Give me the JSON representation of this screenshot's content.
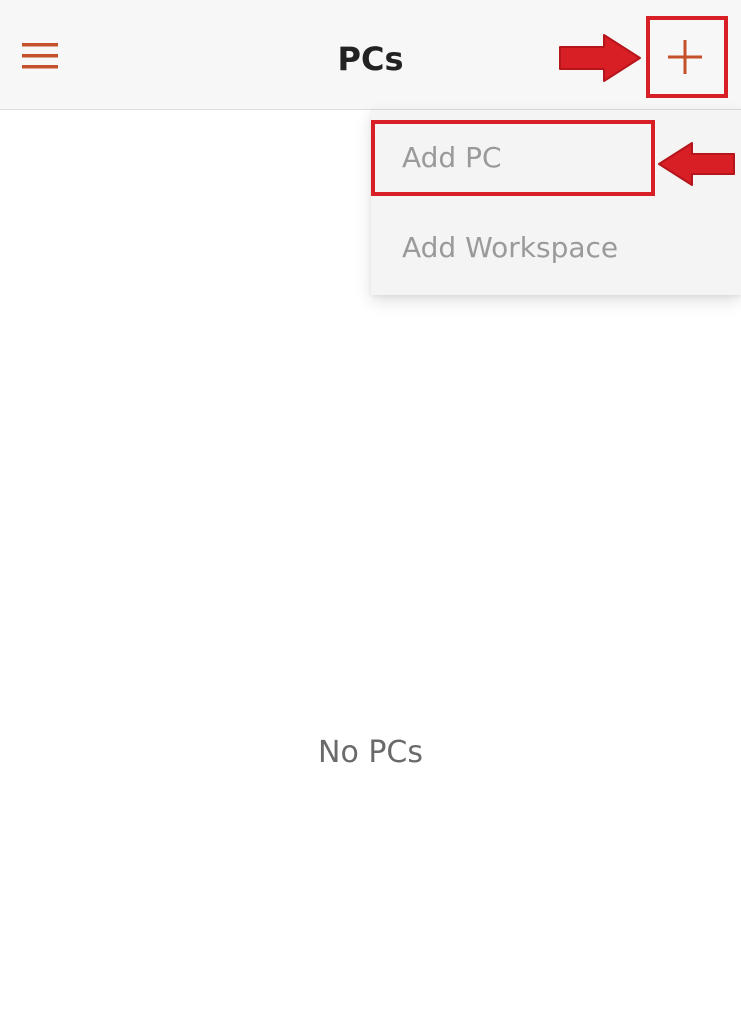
{
  "app_bar": {
    "title": "PCs",
    "menu_icon": "hamburger-menu-icon",
    "add_icon": "plus-icon"
  },
  "dropdown": {
    "items": [
      {
        "label": "Add PC"
      },
      {
        "label": "Add Workspace"
      }
    ]
  },
  "main": {
    "empty_message": "No PCs"
  },
  "colors": {
    "accent": "#c5512a",
    "annotation": "#d91f26",
    "menu_text": "#9a9a9a"
  }
}
